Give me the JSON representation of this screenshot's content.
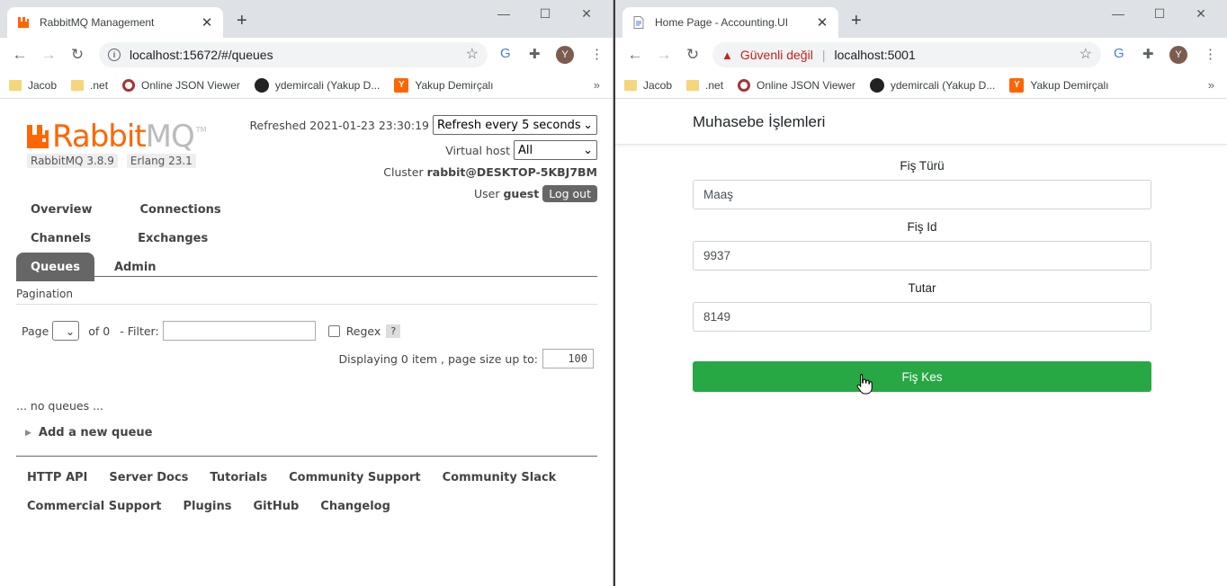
{
  "left_browser": {
    "tab_title": "RabbitMQ Management",
    "tab_close": "✕",
    "new_tab": "+",
    "url": "localhost:15672/#/queues",
    "bookmarks": [
      "Jacob",
      ".net",
      "Online JSON Viewer",
      "ydemircali (Yakup D...",
      "Yakup Demirçalı"
    ],
    "avatar_letter": "Y",
    "more_bookmarks": "»"
  },
  "right_browser": {
    "tab_title": "Home Page - Accounting.UI",
    "tab_close": "✕",
    "new_tab": "+",
    "security_label": "Güvenli değil",
    "url": "localhost:5001",
    "bookmarks": [
      "Jacob",
      ".net",
      "Online JSON Viewer",
      "ydemircali (Yakup D...",
      "Yakup Demirçalı"
    ],
    "avatar_letter": "Y",
    "more_bookmarks": "»"
  },
  "rabbitmq": {
    "logo_rabbit": "Rabbit",
    "logo_mq": "MQ",
    "logo_tm": "TM",
    "version": "RabbitMQ 3.8.9",
    "erlang": "Erlang 23.1",
    "refreshed_label": "Refreshed 2021-01-23 23:30:19",
    "refresh_select": "Refresh every 5 seconds",
    "vhost_label": "Virtual host",
    "vhost_select": "All",
    "cluster_label": "Cluster",
    "cluster_name": "rabbit@DESKTOP-5KBJ7BM",
    "user_label": "User",
    "user_name": "guest",
    "logout": "Log out",
    "nav": {
      "overview": "Overview",
      "connections": "Connections",
      "channels": "Channels",
      "exchanges": "Exchanges",
      "queues": "Queues",
      "admin": "Admin"
    },
    "pagination_title": "Pagination",
    "page_label": "Page",
    "of_label": "of 0",
    "filter_label": "- Filter:",
    "regex_label": "Regex",
    "help": "?",
    "displaying": "Displaying 0 item , page size up to:",
    "page_size": "100",
    "no_queues": "... no queues ...",
    "add_queue": "Add a new queue",
    "footer": {
      "http_api": "HTTP API",
      "server_docs": "Server Docs",
      "tutorials": "Tutorials",
      "community_support": "Community Support",
      "community_slack": "Community Slack",
      "commercial_support": "Commercial Support",
      "plugins": "Plugins",
      "github": "GitHub",
      "changelog": "Changelog"
    }
  },
  "accounting": {
    "brand": "Muhasebe İşlemleri",
    "fields": [
      {
        "label": "Fiş Türü",
        "value": "Maaş"
      },
      {
        "label": "Fiş Id",
        "value": "9937"
      },
      {
        "label": "Tutar",
        "value": "8149"
      }
    ],
    "submit": "Fiş Kes"
  },
  "colors": {
    "rabbit_orange": "#ff6600",
    "submit_green": "#28a745",
    "nav_active": "#666666"
  }
}
